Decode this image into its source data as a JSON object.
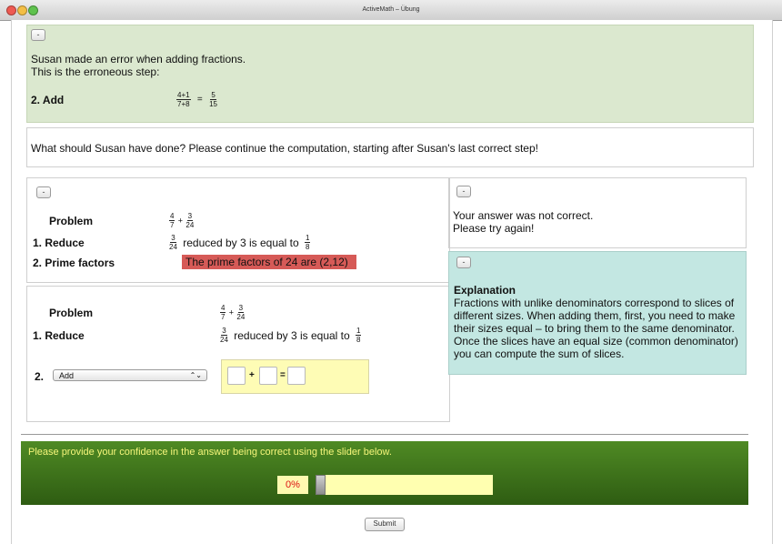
{
  "window": {
    "title": "ActiveMath – Übung"
  },
  "top_panel": {
    "collapse_label": "-",
    "line1": "Susan made an error when adding fractions.",
    "line2": "This is the erroneous step:",
    "step_label": "2. Add",
    "lhs": {
      "num": "4+1",
      "den": "7+8"
    },
    "eq": "=",
    "rhs": {
      "num": "5",
      "den": "15"
    }
  },
  "question": "What should Susan have done? Please continue the computation, starting after Susan's last correct step!",
  "left_panel_1": {
    "collapse_label": "-",
    "problem_label": "Problem",
    "problem_f1": {
      "num": "4",
      "den": "7"
    },
    "plus": "+",
    "problem_f2": {
      "num": "3",
      "den": "24"
    },
    "step1_label": "1. Reduce",
    "step1_f1": {
      "num": "3",
      "den": "24"
    },
    "step1_text": "reduced by 3 is equal to",
    "step1_f2": {
      "num": "1",
      "den": "8"
    },
    "step2_label": "2. Prime factors",
    "step2_text": "The prime factors of 24 are (2,12)"
  },
  "left_panel_2": {
    "problem_label": "Problem",
    "problem_f1": {
      "num": "4",
      "den": "7"
    },
    "plus": "+",
    "problem_f2": {
      "num": "3",
      "den": "24"
    },
    "step1_label": "1. Reduce",
    "step1_f1": {
      "num": "3",
      "den": "24"
    },
    "step1_text": "reduced by 3 is equal to",
    "step1_f2": {
      "num": "1",
      "den": "8"
    },
    "step2_label": "2.",
    "select_value": "Add",
    "select_arrow": "⌃⌄",
    "op_plus": "+",
    "op_eq": "="
  },
  "feedback": {
    "collapse_label": "-",
    "line1": "Your answer was not correct.",
    "line2": "Please try again!"
  },
  "explanation": {
    "collapse_label": "-",
    "title": "Explanation",
    "lines": [
      "Fractions with unlike denominators correspond to slices of",
      "different sizes. When adding them, first, you need to make",
      "their sizes equal – to bring them to the same denominator.",
      "Once the slices have an equal size (common denominator)",
      "you can compute the sum of slices."
    ]
  },
  "confidence": {
    "prompt": "Please provide your confidence in the answer being correct using the slider below.",
    "value_label": "0%",
    "value": 0
  },
  "submit_label": "Submit",
  "colors": {
    "top_bg": "#dbe8cf",
    "error_bg": "#d65a57",
    "explanation_bg": "#c3e7e2",
    "slider_bg": "#3f7a1d",
    "prompt_text": "#f5f57a"
  }
}
